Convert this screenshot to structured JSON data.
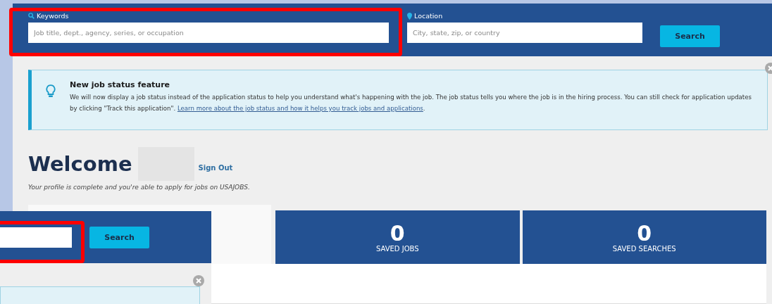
{
  "search": {
    "keywords_label": "Keywords",
    "keywords_placeholder": "Job title, dept., agency, series, or occupation",
    "location_label": "Location",
    "location_placeholder": "City, state, zip, or country",
    "button": "Search"
  },
  "alert": {
    "title": "New job status feature",
    "text": "We will now display a job status instead of the application status to help you understand what's happening with the job. The job status tells you where the job is in the hiring process. You can still check for application updates by clicking \"Track this application\".",
    "link": "Learn more about the job status and how it helps you track jobs and applications",
    "text_after": "."
  },
  "welcome": {
    "heading": "Welcome",
    "sign_out": "Sign Out",
    "note": "Your profile is complete and you're able to apply for jobs on USAJOBS."
  },
  "stats": [
    {
      "value": "0",
      "label": "SAVED JOBS"
    },
    {
      "value": "0",
      "label": "SAVED SEARCHES"
    }
  ],
  "overlay": {
    "button": "Search"
  }
}
